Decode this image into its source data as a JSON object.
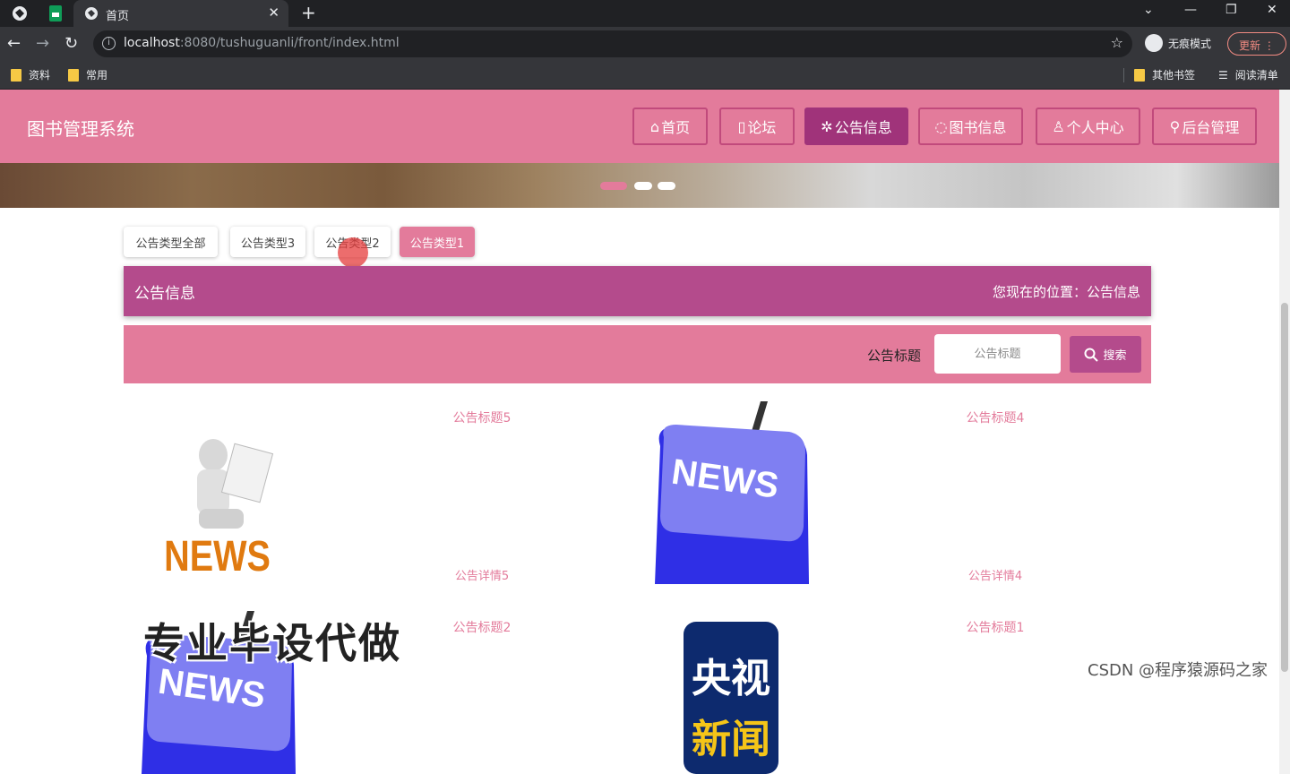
{
  "browser": {
    "tab_title": "首页",
    "url_host": "localhost",
    "url_rest": ":8080/tushuguanli/front/index.html",
    "incognito_label": "无痕模式",
    "update_label": "更新",
    "bookmarks": [
      "资料",
      "常用"
    ],
    "bookmarks_right": [
      "其他书签",
      "阅读清单"
    ]
  },
  "header": {
    "site_title": "图书管理系统",
    "nav": [
      {
        "label": "首页",
        "icon": "home-icon"
      },
      {
        "label": "论坛",
        "icon": "forum-icon"
      },
      {
        "label": "公告信息",
        "icon": "notice-icon",
        "active": true
      },
      {
        "label": "图书信息",
        "icon": "book-icon"
      },
      {
        "label": "个人中心",
        "icon": "user-icon"
      },
      {
        "label": "后台管理",
        "icon": "link-icon"
      }
    ]
  },
  "carousel": {
    "dots": 3,
    "active_index": 0
  },
  "categories": [
    {
      "label": "公告类型全部"
    },
    {
      "label": "公告类型3"
    },
    {
      "label": "公告类型2"
    },
    {
      "label": "公告类型1",
      "active": true
    }
  ],
  "location": {
    "title": "公告信息",
    "where": "您现在的位置：公告信息"
  },
  "search": {
    "label": "公告标题",
    "placeholder": "公告标题",
    "button": "搜索"
  },
  "notices": [
    {
      "title": "公告标题5",
      "desc": "公告详情5",
      "image": "news-figure-image"
    },
    {
      "title": "公告标题4",
      "desc": "公告详情4",
      "image": "news-key-image"
    },
    {
      "title": "公告标题2",
      "desc": "",
      "image": "news-key-image"
    },
    {
      "title": "公告标题1",
      "desc": "",
      "image": "cctv-news-image"
    }
  ],
  "overlay_text": "专业毕设代做",
  "watermark": "CSDN @程序猿源码之家",
  "colors": {
    "pink": "#e37b9b",
    "magenta": "#b44b8c",
    "active_nav": "#a0337a"
  }
}
